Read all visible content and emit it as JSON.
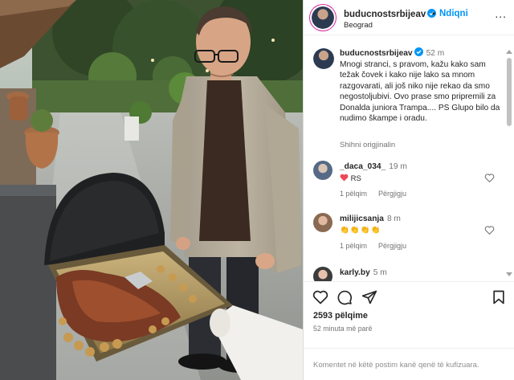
{
  "post": {
    "username": "buducnostsrbijeav",
    "follow_label": "Ndiqni",
    "location": "Beograd",
    "dot": "•",
    "more_label": "...",
    "caption_time": "52 m",
    "caption_text": "Mnogi stranci, s pravom, kažu kako sam težak čovek i kako nije lako sa mnom razgovarati, ali još niko nije rekao da smo negostoljubivi. Ovo prase smo pripremili za Donalda juniora Trampa.... PS Glupo bilo da nudimo škampe i oradu.",
    "see_original": "Shihni origjinalin"
  },
  "comments": [
    {
      "user": "_daca_034_",
      "time": "19 m",
      "text": "RS",
      "likes_label": "1 pëlqim",
      "reply_label": "Përgjigju"
    },
    {
      "user": "milijicsanja",
      "time": "8 m",
      "text": "👏👏👏👏",
      "likes_label": "1 pëlqim",
      "reply_label": "Përgjigju"
    },
    {
      "user": "karly.by",
      "time": "5 m"
    }
  ],
  "actions": {
    "likes_count": "2593 pëlqime",
    "posted_ago": "52 minuta më parë",
    "comment_placeholder": "Komentet në këtë postim kanë qenë të kufizuara."
  },
  "icons": {
    "like": "heart-icon",
    "comment": "comment-icon",
    "share": "send-icon",
    "save": "bookmark-icon",
    "verified": "verified-badge-icon"
  },
  "colors": {
    "accent": "#0095f6",
    "verified": "#0095f6",
    "heart_red": "#ed4956"
  }
}
